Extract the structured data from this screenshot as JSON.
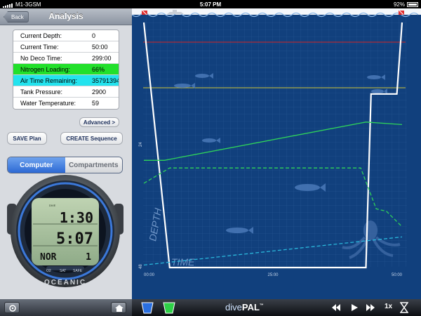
{
  "status": {
    "carrier": "M1-3GSM",
    "time": "5:07 PM",
    "battery": "92%"
  },
  "nav": {
    "back": "Back",
    "title": "Analysis"
  },
  "readouts": [
    {
      "label": "Current Depth:",
      "value": "0"
    },
    {
      "label": "Current Time:",
      "value": "50:00"
    },
    {
      "label": "No Deco Time:",
      "value": "299:00"
    },
    {
      "label": "Nitrogen Loading:",
      "value": "66%"
    },
    {
      "label": "Air Time Remaining:",
      "value": "35791394:"
    },
    {
      "label": "Tank Pressure:",
      "value": "2900"
    },
    {
      "label": "Water Temperature:",
      "value": "59"
    }
  ],
  "buttons": {
    "advanced": "Advanced >",
    "save_plan": "SAVE Plan",
    "create_sequence": "CREATE Sequence"
  },
  "segments": {
    "computer": "Computer",
    "compartments": "Compartments"
  },
  "gauge": {
    "brand": "OCEANIC",
    "line1": "1:30",
    "line2": "5:07",
    "mode": "NOR",
    "mode_value": "1",
    "mark_dive": "DIVE",
    "mark_o2": "O2",
    "mark_sat": "SAT",
    "mark_safe": "SAFE"
  },
  "chart": {
    "depth_label": "DEPTH",
    "time_label": "TIME",
    "y_tick_mid": "24",
    "y_tick_bottom": "48",
    "x_ticks": [
      "00:00",
      "25:00",
      "50:00"
    ],
    "colors": {
      "bg": "#11407d",
      "profile": "#ffffff",
      "nitrogen": "#2fd35a",
      "air": "#2ab8dc",
      "red_line": "#d22828",
      "yellow_line": "#cfc63a"
    }
  },
  "bottom": {
    "brand_prefix": "dive",
    "brand_main": "PAL",
    "brand_tm": "™",
    "speed": "1x"
  },
  "chart_data": {
    "type": "line",
    "x_ticks": [
      "00:00",
      "25:00",
      "50:00"
    ],
    "xlim": [
      0,
      50
    ],
    "series": [
      {
        "x": [
          0,
          5,
          43,
          44,
          49,
          50
        ],
        "y": [
          0,
          48,
          48,
          14,
          14,
          0
        ]
      },
      {
        "x": [
          0,
          4,
          43,
          50
        ],
        "y": [
          27,
          27,
          19.5,
          20
        ]
      },
      {
        "x": [
          0,
          5,
          42,
          45,
          47,
          50
        ],
        "y": [
          31.5,
          28.5,
          28.5,
          36.5,
          37,
          40
        ]
      },
      {
        "x": [
          0,
          50
        ],
        "y": [
          47.5,
          42
        ]
      }
    ]
  }
}
